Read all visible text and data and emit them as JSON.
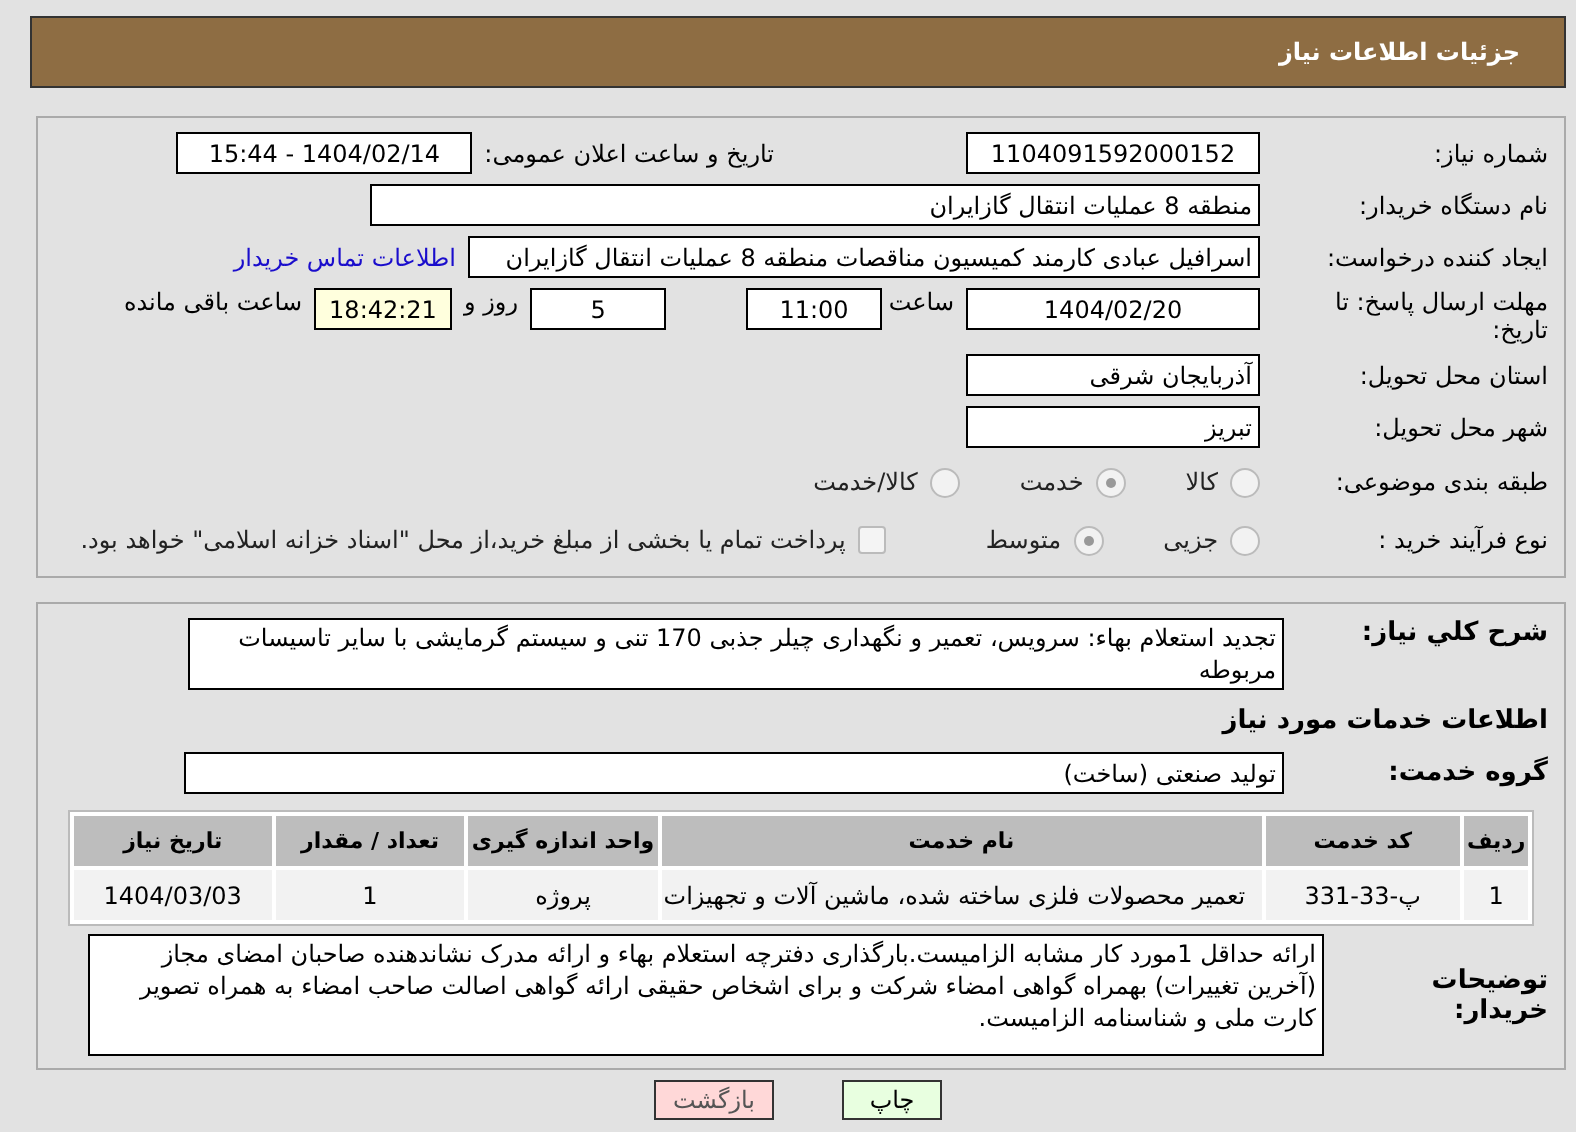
{
  "header": {
    "title": "جزئیات اطلاعات نیاز"
  },
  "need_number": {
    "label": "شماره نیاز:",
    "value": "1104091592000152"
  },
  "announce": {
    "label": "تاریخ و ساعت اعلان عمومی:",
    "value": "1404/02/14 - 15:44"
  },
  "buyer": {
    "label": "نام دستگاه خریدار:",
    "value": "منطقه 8 عملیات انتقال گازایران"
  },
  "creator": {
    "label": "ایجاد کننده درخواست:",
    "value": "اسرافیل عبادی کارمند کمیسیون مناقصات منطقه 8 عملیات انتقال گازایران",
    "link": "اطلاعات تماس خریدار"
  },
  "deadline": {
    "label": "مهلت ارسال پاسخ: تا تاریخ:",
    "date": "1404/02/20",
    "time_label": "ساعت",
    "time": "11:00",
    "days": "5",
    "days_label": "روز و",
    "remaining": "18:42:21",
    "remaining_label": "ساعت باقی مانده"
  },
  "province": {
    "label": "استان محل تحویل:",
    "value": "آذربایجان شرقی"
  },
  "city": {
    "label": "شهر محل تحویل:",
    "value": "تبریز"
  },
  "category": {
    "label": "طبقه بندی موضوعی:",
    "options": [
      {
        "label": "کالا",
        "selected": false
      },
      {
        "label": "خدمت",
        "selected": true
      },
      {
        "label": "کالا/خدمت",
        "selected": false
      }
    ]
  },
  "process": {
    "label": "نوع فرآیند خرید :",
    "options": [
      {
        "label": "جزیی",
        "selected": false
      },
      {
        "label": "متوسط",
        "selected": true
      }
    ],
    "payment": {
      "checked": false,
      "label": "پرداخت تمام یا بخشی از مبلغ خرید،از محل \"اسناد خزانه اسلامی\" خواهد بود."
    }
  },
  "description": {
    "label": "شرح کلي نياز:",
    "value": "تجدید استعلام بهاء: سرویس، تعمیر و نگهداری چیلر جذبی 170 تنی و سیستم گرمایشی با سایر تاسیسات مربوطه"
  },
  "services_heading": "اطلاعات خدمات مورد نیاز",
  "service_group": {
    "label": "گروه خدمت:",
    "value": "تولید صنعتی (ساخت)"
  },
  "table": {
    "columns": [
      "ردیف",
      "کد خدمت",
      "نام خدمت",
      "واحد اندازه گیری",
      "تعداد / مقدار",
      "تاریخ نیاز"
    ],
    "rows": [
      [
        "1",
        "پ-33-331",
        "تعمیر محصولات فلزی ساخته شده، ماشین آلات و تجهیزات",
        "پروژه",
        "1",
        "1404/03/03"
      ]
    ]
  },
  "notes": {
    "label": "توضیحات خریدار:",
    "value": "ارائه حداقل 1مورد کار مشابه الزامیست.بارگذاری دفترچه استعلام بهاء و ارائه مدرک نشاندهنده صاحبان امضای مجاز (آخرین تغییرات) بهمراه گواهی امضاء شرکت و برای اشخاص حقیقی ارائه گواهی اصالت صاحب امضاء به همراه تصویر کارت ملی و شناسنامه الزامیست."
  },
  "buttons": [
    {
      "kind": "print",
      "label": "چاپ"
    },
    {
      "kind": "back",
      "label": "بازگشت"
    }
  ]
}
